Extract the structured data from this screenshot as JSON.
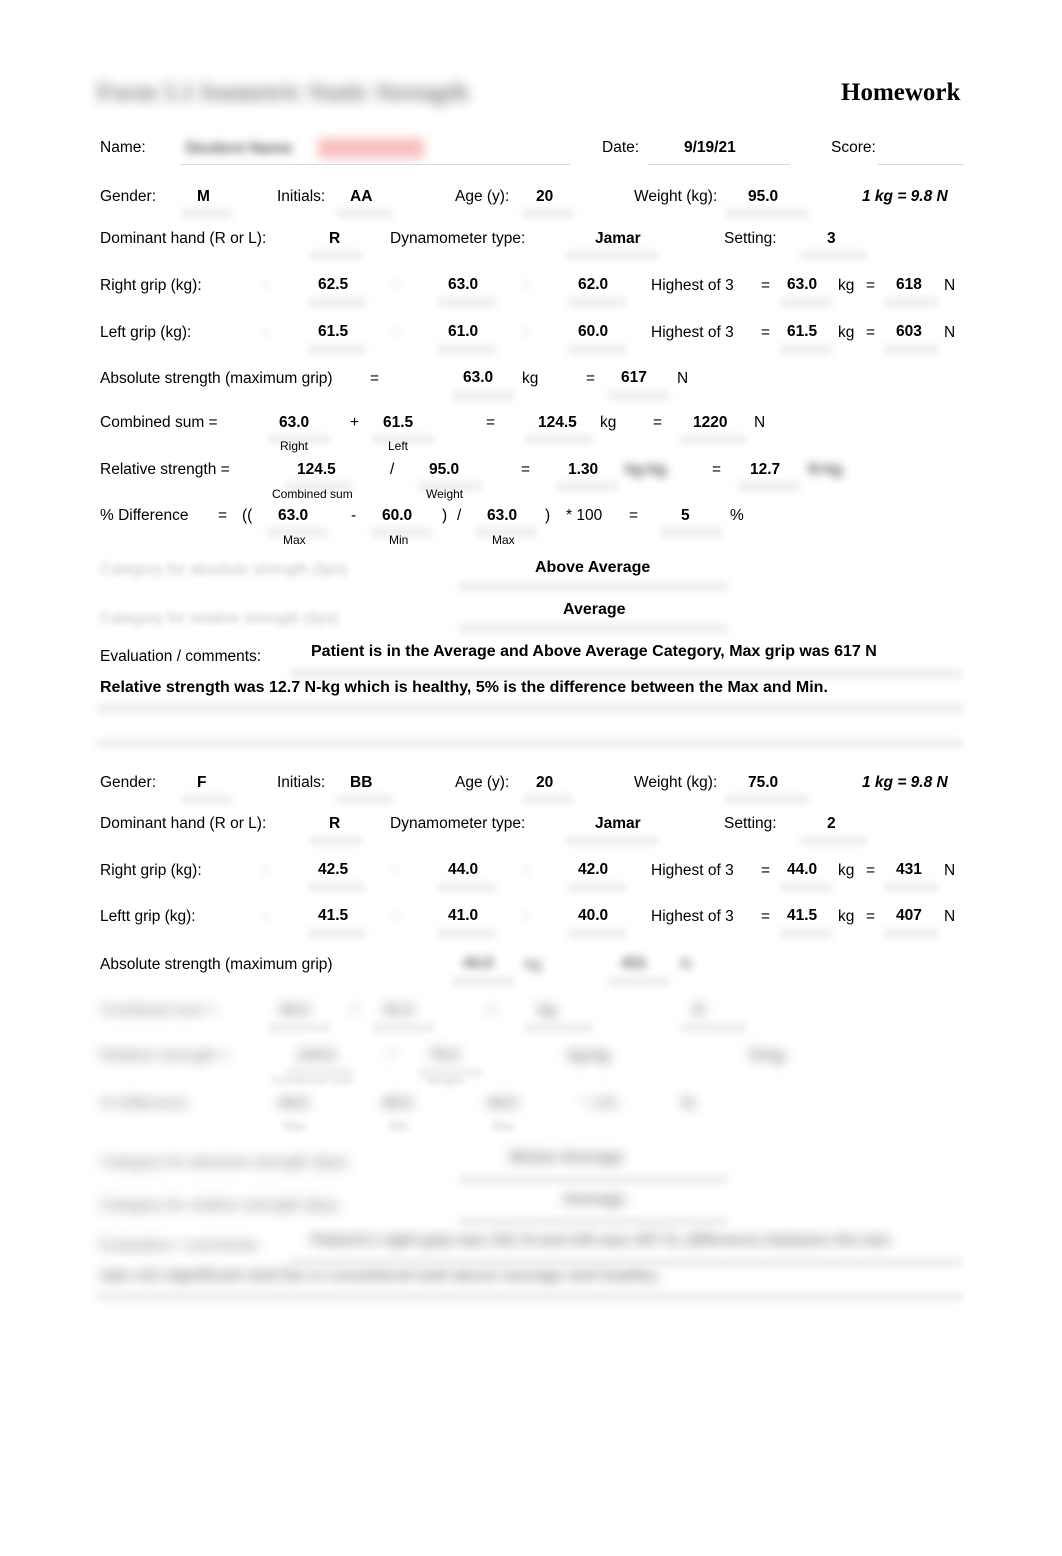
{
  "document": {
    "title_redacted": "Form 5.1    Isometric Static Strength",
    "header_right": "Homework",
    "units_note": "1 kg = 9.8 N"
  },
  "identity": {
    "name_label": "Name:",
    "name_value_redacted": "Student Name",
    "date_label": "Date:",
    "date_value": "9/19/21",
    "score_label": "Score:",
    "score_value": ""
  },
  "trials": [
    {
      "id": "trial-1",
      "gender_label": "Gender:",
      "gender_value": "M",
      "initials_label": "Initials:",
      "initials_value": "AA",
      "age_label": "Age (y):",
      "age_value": "20",
      "weight_label": "Weight (kg):",
      "weight_value": "95.0",
      "units_note": "1 kg = 9.8 N",
      "dominant_label": "Dominant hand (R or L):",
      "dominant_value": "R",
      "dynamometer_label": "Dynamometer type:",
      "dynamometer_value": "Jamar",
      "setting_label": "Setting:",
      "setting_value": "3",
      "right_grip": {
        "label": "Right grip (kg):",
        "t1": "62.5",
        "t2": "63.0",
        "t3": "62.0",
        "highest_label": "Highest of 3",
        "eq1": "=",
        "highest_kg": "63.0",
        "kg_unit": "kg",
        "eq2": "=",
        "highest_n": "618",
        "n_unit": "N"
      },
      "left_grip": {
        "label": "Left grip (kg):",
        "t1": "61.5",
        "t2": "61.0",
        "t3": "60.0",
        "highest_label": "Highest of 3",
        "eq1": "=",
        "highest_kg": "61.5",
        "kg_unit": "kg",
        "eq2": "=",
        "highest_n": "603",
        "n_unit": "N"
      },
      "absolute": {
        "label": "Absolute strength (maximum grip)",
        "eq0": "=",
        "kg_value": "63.0",
        "kg_unit": "kg",
        "eq1": "=",
        "n_value": "617",
        "n_unit": "N"
      },
      "combined": {
        "label": "Combined sum =",
        "right_value": "63.0",
        "right_caption": "Right",
        "plus": "+",
        "left_value": "61.5",
        "left_caption": "Left",
        "eq1": "=",
        "kg_value": "124.5",
        "kg_unit": "kg",
        "eq2": "=",
        "n_value": "1220",
        "n_unit": "N"
      },
      "relative": {
        "label": "Relative strength =",
        "combined_value": "124.5",
        "combined_caption": "Combined sum",
        "slash": "/",
        "weight_value": "95.0",
        "weight_caption": "Weight",
        "eq1": "=",
        "ratio_value": "1.30",
        "ratio_unit_redacted": "kg-kg",
        "eq2": "=",
        "n_kg_value": "12.7",
        "n_kg_unit_redacted": "N-kg"
      },
      "percent_difference": {
        "label": "% Difference",
        "eq0": "=",
        "open": "((",
        "max_value": "63.0",
        "max_caption": "Max",
        "minus": "-",
        "min_value": "60.0",
        "min_caption": "Min",
        "close1": ")",
        "slash": "/",
        "max2_value": "63.0",
        "max2_caption": "Max",
        "close2": ")",
        "times": "* 100",
        "eq1": "=",
        "result": "5",
        "pct_unit": "%"
      },
      "categories": [
        {
          "label_redacted": "Category for absolute strength (tips)",
          "value": "Above Average"
        },
        {
          "label_redacted": "Category for relative strength (tips)",
          "value": "Average"
        }
      ],
      "evaluation": {
        "label": "Evaluation / comments:",
        "line1": "Patient is in the Average and Above Average Category, Max grip was 617 N",
        "line2": "Relative strength was 12.7 N-kg which is healthy, 5% is the difference between the Max and Min."
      }
    },
    {
      "id": "trial-2",
      "gender_label": "Gender:",
      "gender_value": "F",
      "initials_label": "Initials:",
      "initials_value": "BB",
      "age_label": "Age (y):",
      "age_value": "20",
      "weight_label": "Weight (kg):",
      "weight_value": "75.0",
      "units_note": "1 kg = 9.8 N",
      "dominant_label": "Dominant hand (R or L):",
      "dominant_value": "R",
      "dynamometer_label": "Dynamometer type:",
      "dynamometer_value": "Jamar",
      "setting_label": "Setting:",
      "setting_value": "2",
      "right_grip": {
        "label": "Right grip (kg):",
        "t1": "42.5",
        "t2": "44.0",
        "t3": "42.0",
        "highest_label": "Highest of 3",
        "eq1": "=",
        "highest_kg": "44.0",
        "kg_unit": "kg",
        "eq2": "=",
        "highest_n": "431",
        "n_unit": "N"
      },
      "left_grip": {
        "label": "Leftt grip (kg):",
        "t1": "41.5",
        "t2": "41.0",
        "t3": "40.0",
        "highest_label": "Highest of 3",
        "eq1": "=",
        "highest_kg": "41.5",
        "kg_unit": "kg",
        "eq2": "=",
        "highest_n": "407",
        "n_unit": "N"
      },
      "absolute": {
        "label": "Absolute strength (maximum grip)",
        "kg_value_redacted": "44.0",
        "kg_unit_redacted": "kg",
        "n_value_redacted": "431",
        "n_unit_redacted": "N"
      },
      "combined_redacted": "Combined sum =",
      "relative_redacted": "Relative strength =",
      "percent_difference_redacted": "% Difference",
      "categories_redacted": [
        {
          "label_redacted": "Category for absolute strength (tips)",
          "value_redacted": "Below Average"
        },
        {
          "label_redacted": "Category for relative strength (tips)",
          "value_redacted": "Average"
        }
      ],
      "evaluation_redacted": {
        "label_redacted": "Evaluation / comments:",
        "line1_redacted": "Patient's right grip was 431 N and left was 407 N, difference between the two",
        "line2_redacted": "was not significant and the is considered well above average and healthy."
      }
    }
  ],
  "captions": {
    "trial_markers": [
      "1.",
      "2.",
      "3."
    ]
  }
}
